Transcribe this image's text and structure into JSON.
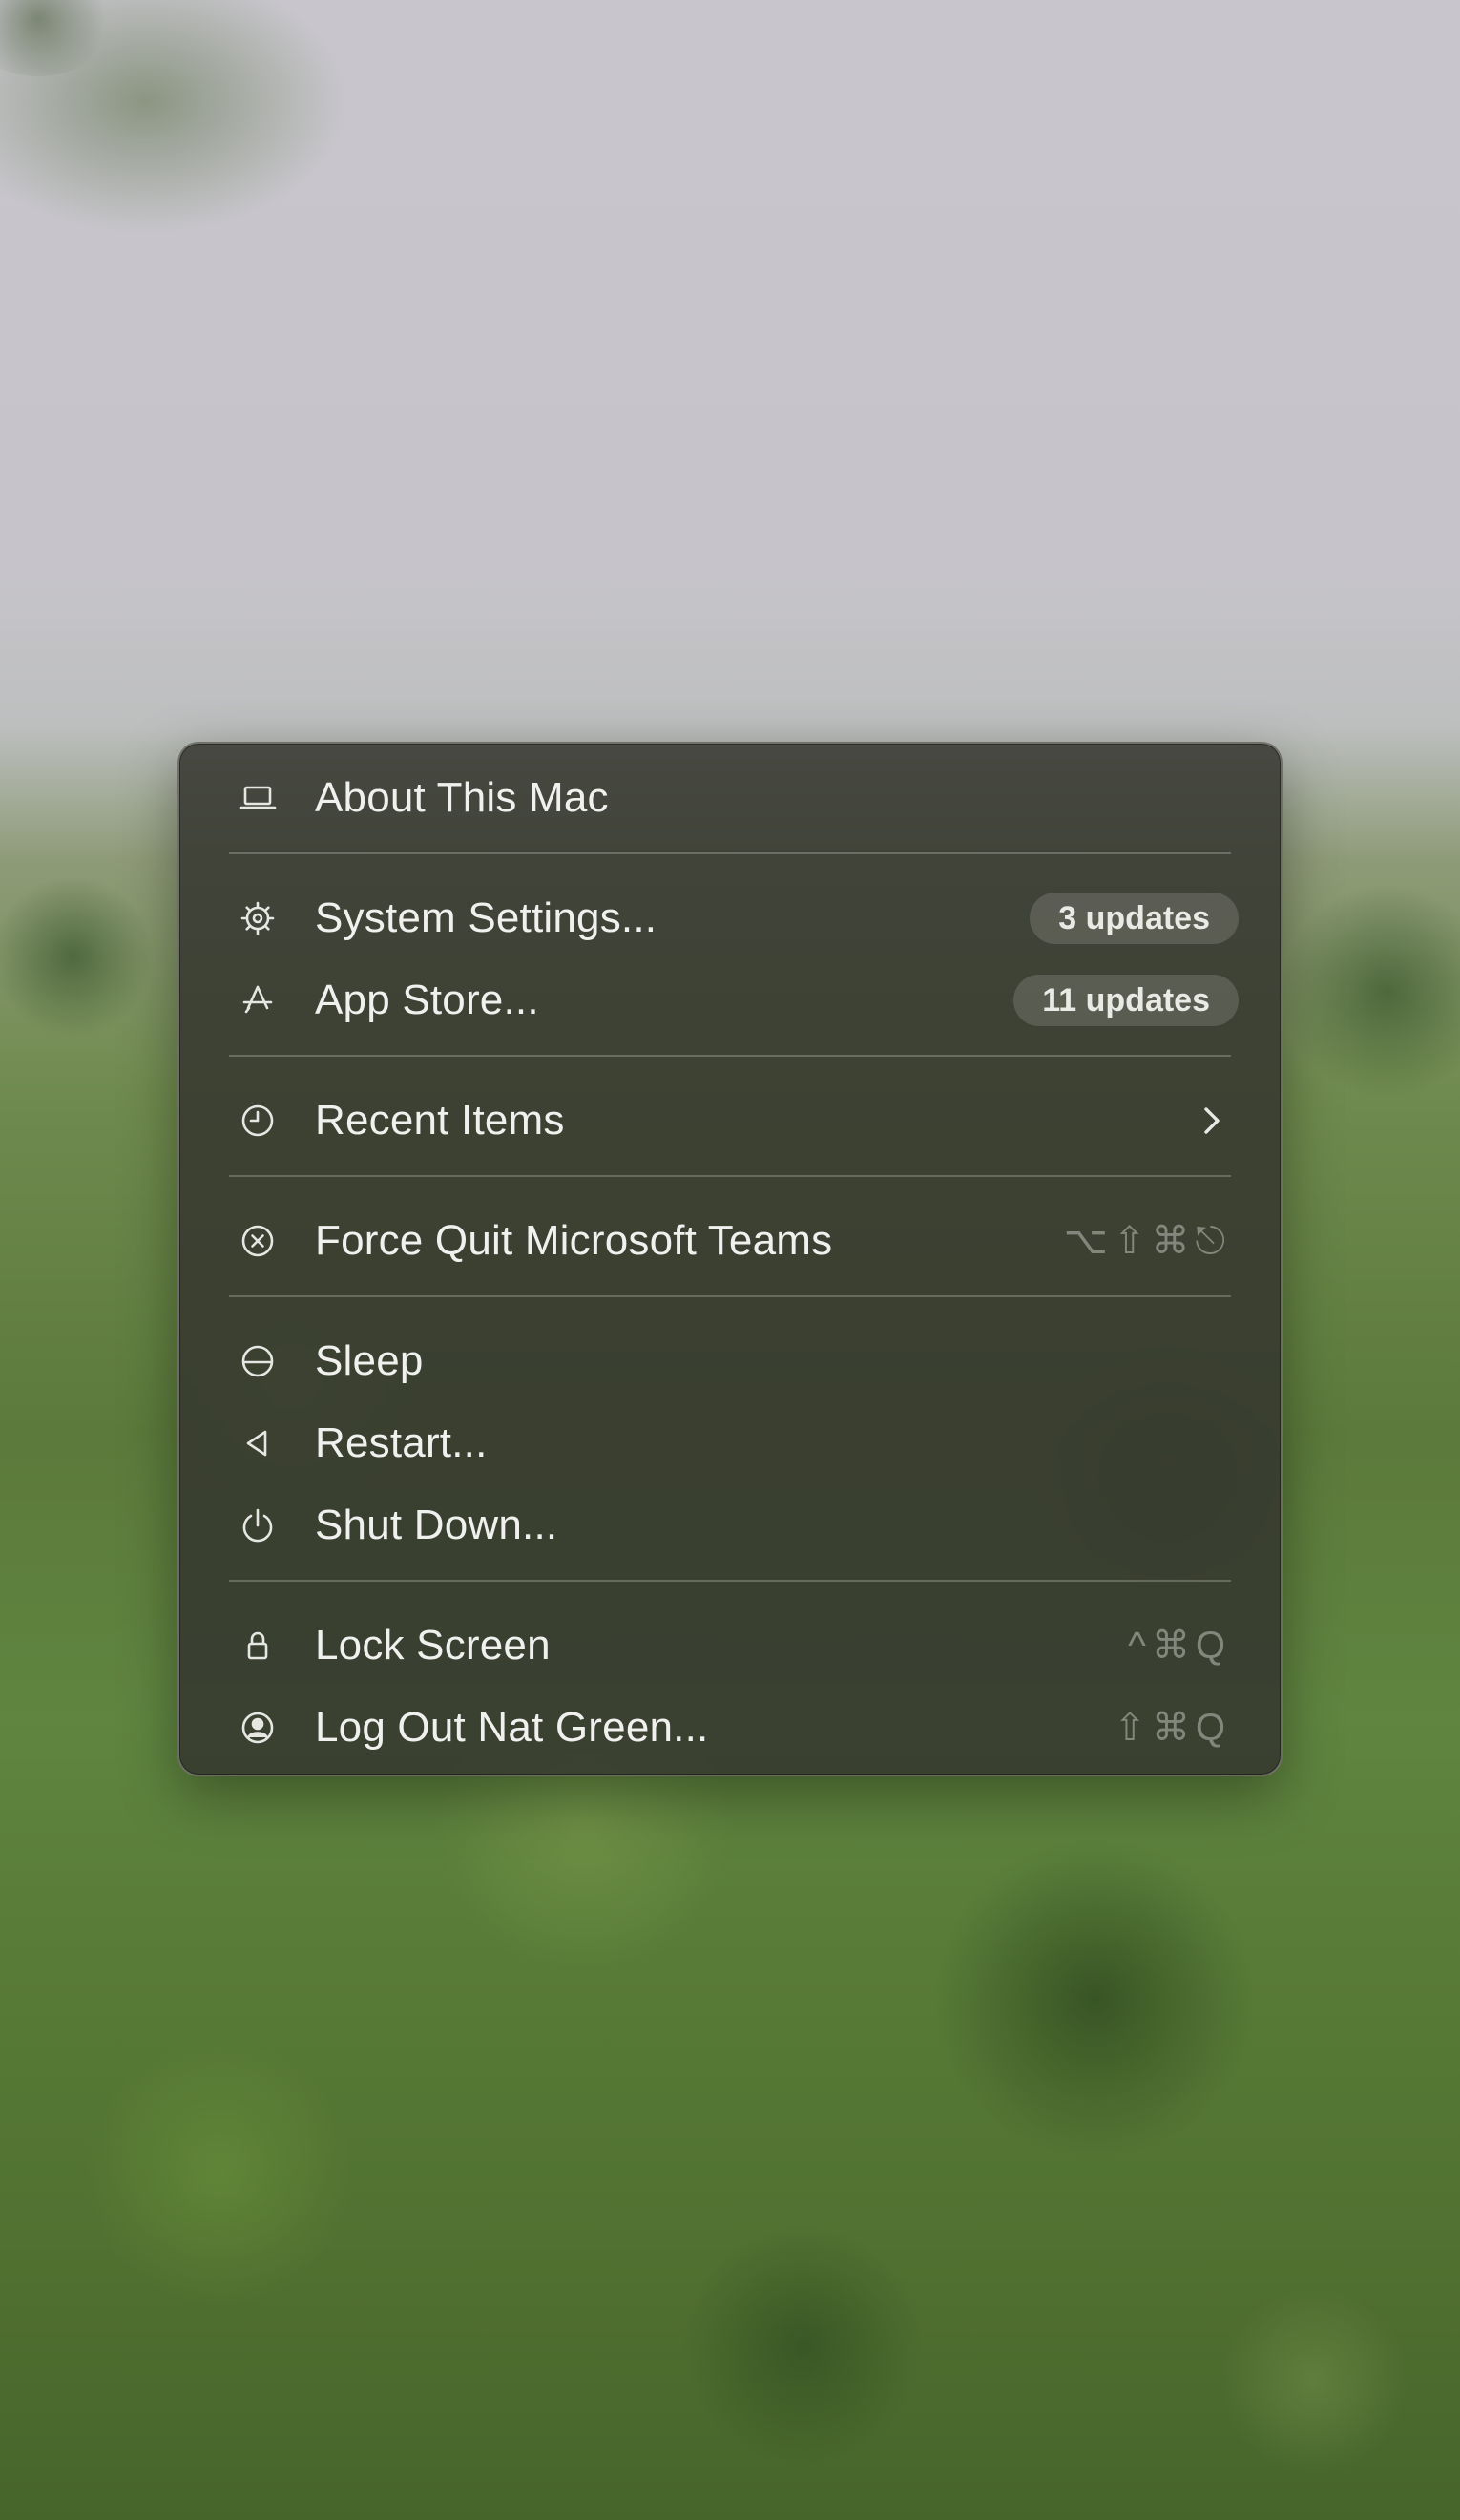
{
  "menu": {
    "about": {
      "label": "About This Mac",
      "icon": "laptop-icon"
    },
    "system_settings": {
      "label": "System Settings...",
      "badge": "3 updates",
      "icon": "gear-icon"
    },
    "app_store": {
      "label": "App Store...",
      "badge": "11 updates",
      "icon": "app-store-icon"
    },
    "recent_items": {
      "label": "Recent Items",
      "icon": "clock-icon",
      "submenu_icon": "chevron-right-icon"
    },
    "force_quit": {
      "label": "Force Quit Microsoft Teams",
      "shortcut": "⌥⇧⌘⎋",
      "icon": "x-circle-icon"
    },
    "sleep": {
      "label": "Sleep",
      "icon": "sleep-icon"
    },
    "restart": {
      "label": "Restart...",
      "icon": "restart-icon"
    },
    "shut_down": {
      "label": "Shut Down...",
      "icon": "power-icon"
    },
    "lock_screen": {
      "label": "Lock Screen",
      "shortcut": "^⌘Q",
      "icon": "lock-icon"
    },
    "log_out": {
      "label": "Log Out Nat Green...",
      "shortcut": "⇧⌘Q",
      "icon": "user-circle-icon"
    }
  },
  "colors": {
    "menu_background": "#34362e",
    "menu_text": "#f0f0ee",
    "shortcut_text": "#8a8a85",
    "badge_background": "#5a5c55"
  }
}
